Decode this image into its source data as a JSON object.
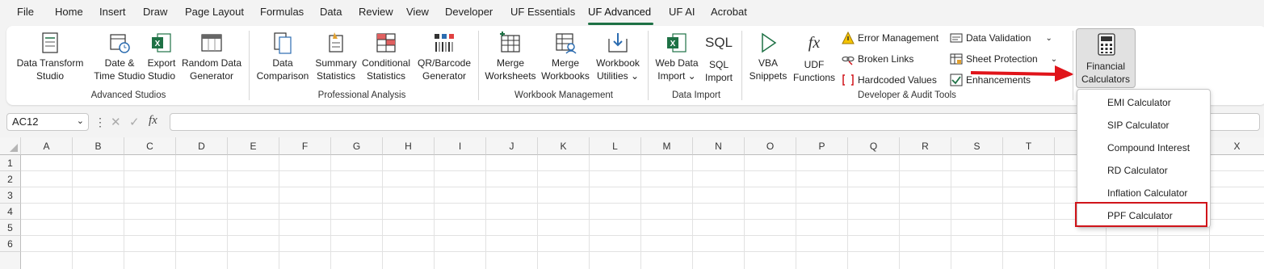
{
  "menu": {
    "tabs": [
      "File",
      "Home",
      "Insert",
      "Draw",
      "Page Layout",
      "Formulas",
      "Data",
      "Review",
      "View",
      "Developer",
      "UF Essentials",
      "UF Advanced",
      "UF AI",
      "Acrobat"
    ],
    "active": "UF Advanced"
  },
  "ribbon": {
    "groups": {
      "advanced_studios": "Advanced Studios",
      "professional_analysis": "Professional Analysis",
      "workbook_management": "Workbook Management",
      "data_import": "Data Import",
      "developer_audit": "Developer & Audit Tools"
    },
    "buttons": {
      "data_transform": [
        "Data Transform",
        "Studio"
      ],
      "date_time": [
        "Date &",
        "Time Studio"
      ],
      "export": [
        "Export",
        "Studio"
      ],
      "random": [
        "Random Data",
        "Generator"
      ],
      "data_comparison": [
        "Data",
        "Comparison"
      ],
      "summary": [
        "Summary",
        "Statistics"
      ],
      "conditional": [
        "Conditional",
        "Statistics"
      ],
      "qr": [
        "QR/Barcode",
        "Generator"
      ],
      "merge_ws": [
        "Merge",
        "Worksheets"
      ],
      "merge_wb": [
        "Merge",
        "Workbooks"
      ],
      "wb_utils": [
        "Workbook",
        "Utilities ⌄"
      ],
      "web_import": [
        "Web Data",
        "Import ⌄"
      ],
      "sql_import": [
        "SQL",
        "Import"
      ],
      "vba": [
        "VBA",
        "Snippets"
      ],
      "udf": [
        "UDF",
        "Functions"
      ],
      "financial": [
        "Financial",
        "Calculators ⌄"
      ]
    },
    "small": {
      "error_mgmt": "Error Management",
      "broken_links": "Broken Links",
      "hardcoded": "Hardcoded Values",
      "data_validation": "Data Validation",
      "sheet_protection": "Sheet Protection",
      "enhancements": "Enhancements"
    },
    "sql_icon_text": "SQL",
    "fx_icon_text": "fx"
  },
  "formula_bar": {
    "name_box": "AC12",
    "fx_label": "fx",
    "formula": ""
  },
  "grid": {
    "columns": [
      "A",
      "B",
      "C",
      "D",
      "E",
      "F",
      "G",
      "H",
      "I",
      "J",
      "K",
      "L",
      "M",
      "N",
      "O",
      "P",
      "Q",
      "R",
      "S",
      "T",
      "X"
    ],
    "rows": [
      "1",
      "2",
      "3",
      "4",
      "5",
      "6"
    ]
  },
  "dropdown": {
    "items": [
      "EMI Calculator",
      "SIP Calculator",
      "Compound Interest",
      "RD Calculator",
      "Inflation Calculator",
      "PPF Calculator"
    ],
    "highlighted": "PPF Calculator"
  },
  "colors": {
    "accent": "#1e7145",
    "highlight": "#d0141a",
    "arrow": "#e0141a"
  }
}
